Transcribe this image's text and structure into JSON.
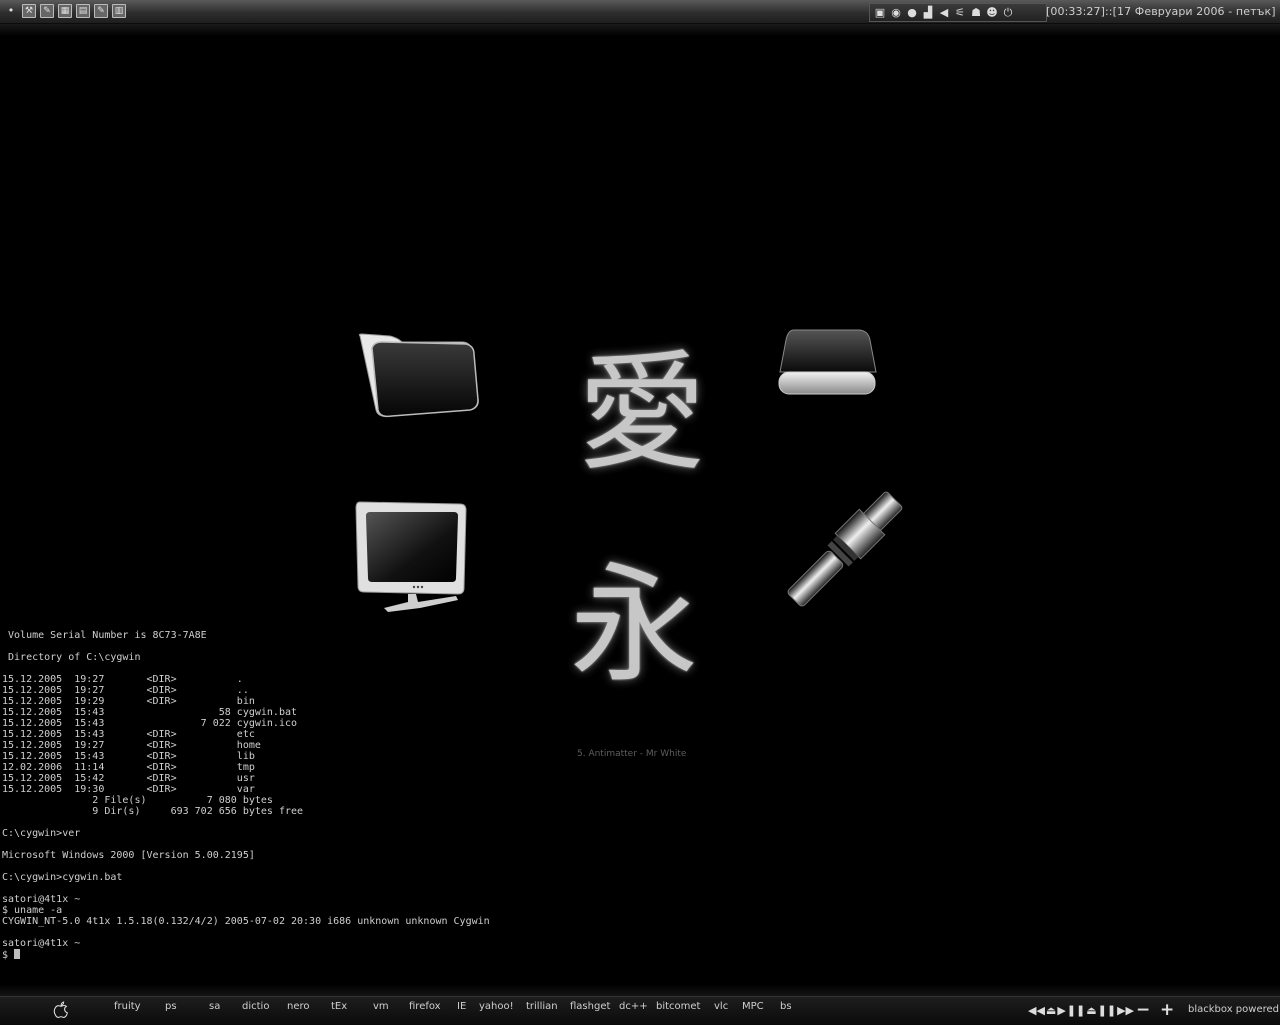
{
  "topbar": {
    "launcher_icons": [
      "menu-dot-icon",
      "wrench-icon",
      "notepad-icon",
      "image-icon",
      "folder-icon",
      "note-icon",
      "document-icon"
    ],
    "tray_icons": [
      "display-icon",
      "globe-icon",
      "sphere-icon",
      "chart-icon",
      "speaker-icon",
      "network-icon",
      "users-icon",
      "smiley-icon",
      "power-icon"
    ],
    "clock": "[00:33:27]::[17 Февруари 2006 - петък]"
  },
  "desktop": {
    "kanji_top": "愛",
    "kanji_bottom": "永",
    "now_playing": "5. Antimatter - Mr White"
  },
  "terminal": {
    "lines": [
      " Volume Serial Number is 8C73-7A8E",
      "",
      " Directory of C:\\cygwin",
      "",
      "15.12.2005  19:27       <DIR>          .",
      "15.12.2005  19:27       <DIR>          ..",
      "15.12.2005  19:29       <DIR>          bin",
      "15.12.2005  15:43                   58 cygwin.bat",
      "15.12.2005  15:43                7 022 cygwin.ico",
      "15.12.2005  15:43       <DIR>          etc",
      "15.12.2005  19:27       <DIR>          home",
      "15.12.2005  15:43       <DIR>          lib",
      "12.02.2006  11:14       <DIR>          tmp",
      "15.12.2005  15:42       <DIR>          usr",
      "15.12.2005  19:30       <DIR>          var",
      "               2 File(s)          7 080 bytes",
      "               9 Dir(s)     693 702 656 bytes free",
      "",
      "C:\\cygwin>ver",
      "",
      "Microsoft Windows 2000 [Version 5.00.2195]",
      "",
      "C:\\cygwin>cygwin.bat",
      "",
      "satori@4t1x ~",
      "$ uname -a",
      "CYGWIN_NT-5.0 4t1x 1.5.18(0.132/4/2) 2005-07-02 20:30 i686 unknown unknown Cygwin",
      "",
      "satori@4t1x ~"
    ],
    "prompt": "$ "
  },
  "taskbar": {
    "items": [
      "fruity",
      "ps",
      "sa",
      "dictio",
      "nero",
      "tEx",
      "vm",
      "firefox",
      "IE",
      "yahoo!",
      "trillian",
      "flashget",
      "dc++",
      "bitcomet",
      "vlc",
      "MPC",
      "bs"
    ],
    "media_controls": [
      "◀◀",
      "⏏",
      "▶",
      "❚❚",
      "⏏",
      "❚❚",
      "▶▶"
    ],
    "zoom_out": "−",
    "zoom_in": "+",
    "brand": "blackbox powered"
  }
}
